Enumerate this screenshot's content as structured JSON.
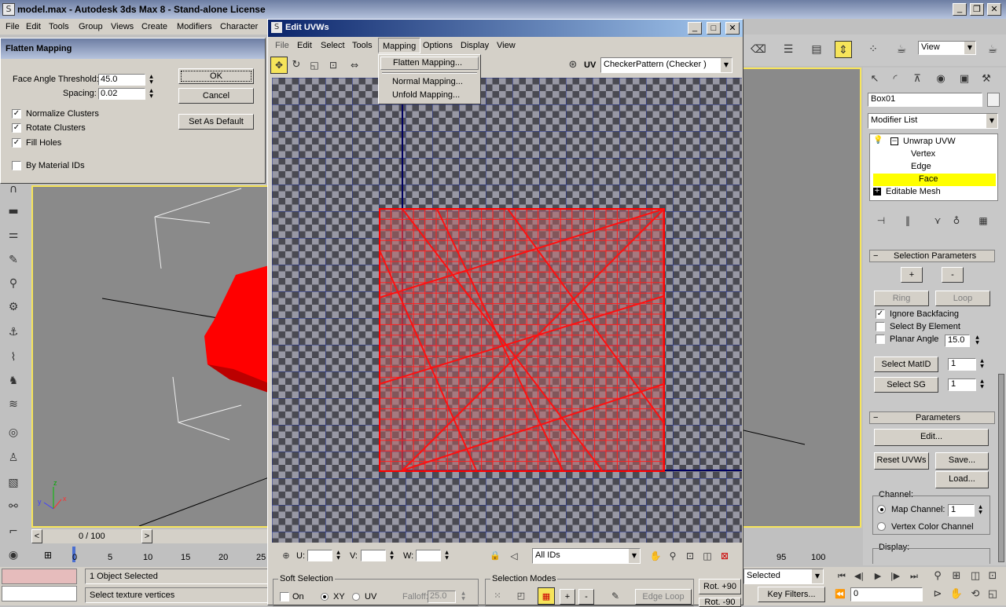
{
  "title_bar": {
    "title": "model.max - Autodesk 3ds Max 8 - Stand-alone License"
  },
  "main_menu": [
    "File",
    "Edit",
    "Tools",
    "Group",
    "Views",
    "Create",
    "Modifiers",
    "Character"
  ],
  "flatten": {
    "title": "Flatten Mapping",
    "face_angle_label": "Face Angle Threshold:",
    "face_angle_value": "45.0",
    "spacing_label": "Spacing:",
    "spacing_value": "0.02",
    "normalize": "Normalize Clusters",
    "rotate": "Rotate Clusters",
    "fill": "Fill Holes",
    "by_material": "By Material IDs",
    "ok": "OK",
    "cancel": "Cancel",
    "set_default": "Set As Default"
  },
  "uvw": {
    "title": "Edit UVWs",
    "menu": [
      "File",
      "Edit",
      "Select",
      "Tools",
      "Mapping",
      "Options",
      "Display",
      "View"
    ],
    "dropdown": [
      "Flatten Mapping...",
      "Normal Mapping...",
      "Unfold Mapping..."
    ],
    "uv_label": "UV",
    "texture_select": "CheckerPattern  (Checker )",
    "u_label": "U:",
    "v_label": "V:",
    "w_label": "W:",
    "ids_select": "All IDs"
  },
  "command_panel": {
    "object_name": "Box01",
    "modifier_list": "Modifier List",
    "stack": [
      "Unwrap UVW",
      "Vertex",
      "Edge",
      "Face",
      "Editable Mesh"
    ],
    "selection_params": "Selection Parameters",
    "plus": "+",
    "minus": "-",
    "ring": "Ring",
    "loop": "Loop",
    "ignore_backfacing": "Ignore Backfacing",
    "select_by_element": "Select By Element",
    "planar_angle": "Planar Angle",
    "planar_value": "15.0",
    "select_matid": "Select MatID",
    "matid_value": "1",
    "select_sg": "Select SG",
    "sg_value": "1",
    "parameters": "Parameters",
    "edit": "Edit...",
    "reset_uvws": "Reset UVWs",
    "save": "Save...",
    "load": "Load...",
    "channel": "Channel:",
    "map_channel": "Map Channel:",
    "map_channel_value": "1",
    "vertex_color": "Vertex Color Channel",
    "display": "Display:"
  },
  "toolbar": {
    "view_select": "View"
  },
  "time": {
    "slider": "0 / 100",
    "ticks_left": [
      "0",
      "5",
      "10",
      "15",
      "20",
      "25"
    ],
    "ticks_right": [
      "95",
      "100"
    ]
  },
  "status": {
    "selected": "1 Object Selected",
    "prompt": "Select texture vertices",
    "selected_select": "Selected",
    "key_filters": "Key Filters...",
    "frame": "0"
  },
  "soft_sel": {
    "title": "Soft Selection",
    "on": "On",
    "xy": "XY",
    "uv": "UV",
    "falloff_label": "Falloff:",
    "falloff_value": "25.0"
  },
  "sel_modes": {
    "title": "Selection Modes",
    "plus": "+",
    "minus": "-",
    "edge_loop": "Edge Loop"
  },
  "rot_buttons": [
    "Rot. +90",
    "Rot. -90"
  ],
  "colors": {
    "uv_bg": "#505060",
    "selection": "#ffff00",
    "mesh": "#ff0000",
    "title_active": "#0a246a"
  }
}
